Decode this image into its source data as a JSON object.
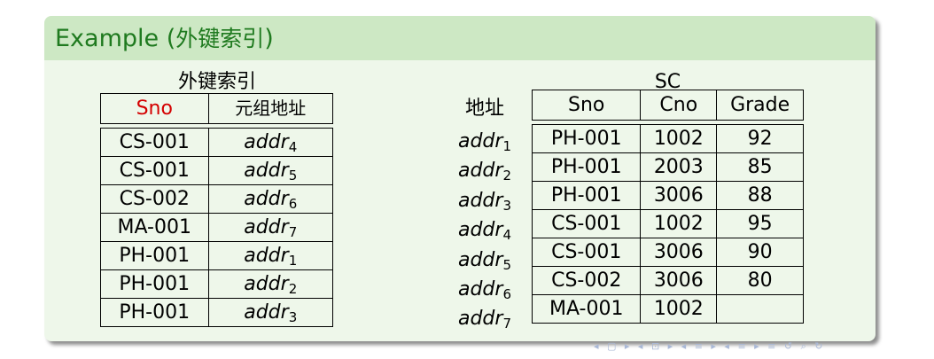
{
  "slide": {
    "block_title_latin": "Example (",
    "block_title_cjk": "外键索引",
    "block_title_close": ")"
  },
  "index_table": {
    "caption": "外键索引",
    "headers": [
      "Sno",
      "元组地址"
    ],
    "rows": [
      {
        "sno": "CS-001",
        "addr": "addr",
        "n": "4"
      },
      {
        "sno": "CS-001",
        "addr": "addr",
        "n": "5"
      },
      {
        "sno": "CS-002",
        "addr": "addr",
        "n": "6"
      },
      {
        "sno": "MA-001",
        "addr": "addr",
        "n": "7"
      },
      {
        "sno": "PH-001",
        "addr": "addr",
        "n": "1"
      },
      {
        "sno": "PH-001",
        "addr": "addr",
        "n": "2"
      },
      {
        "sno": "PH-001",
        "addr": "addr",
        "n": "3"
      }
    ]
  },
  "sc_table": {
    "caption": "SC",
    "address_header": "地址",
    "headers": [
      "Sno",
      "Cno",
      "Grade"
    ],
    "addresses": [
      {
        "addr": "addr",
        "n": "1"
      },
      {
        "addr": "addr",
        "n": "2"
      },
      {
        "addr": "addr",
        "n": "3"
      },
      {
        "addr": "addr",
        "n": "4"
      },
      {
        "addr": "addr",
        "n": "5"
      },
      {
        "addr": "addr",
        "n": "6"
      },
      {
        "addr": "addr",
        "n": "7"
      }
    ],
    "rows": [
      {
        "sno": "PH-001",
        "cno": "1002",
        "grade": "92"
      },
      {
        "sno": "PH-001",
        "cno": "2003",
        "grade": "85"
      },
      {
        "sno": "PH-001",
        "cno": "3006",
        "grade": "88"
      },
      {
        "sno": "CS-001",
        "cno": "1002",
        "grade": "95"
      },
      {
        "sno": "CS-001",
        "cno": "3006",
        "grade": "90"
      },
      {
        "sno": "CS-002",
        "cno": "3006",
        "grade": "80"
      },
      {
        "sno": "MA-001",
        "cno": "1002",
        "grade": ""
      }
    ]
  },
  "nav": {
    "symbols": "◂ ▢ ▸ ◂ ⊡ ▸ ◂ ≡ ▸ ◂ ≡ ▸   ≡   ↺ ⌕ ↻"
  }
}
